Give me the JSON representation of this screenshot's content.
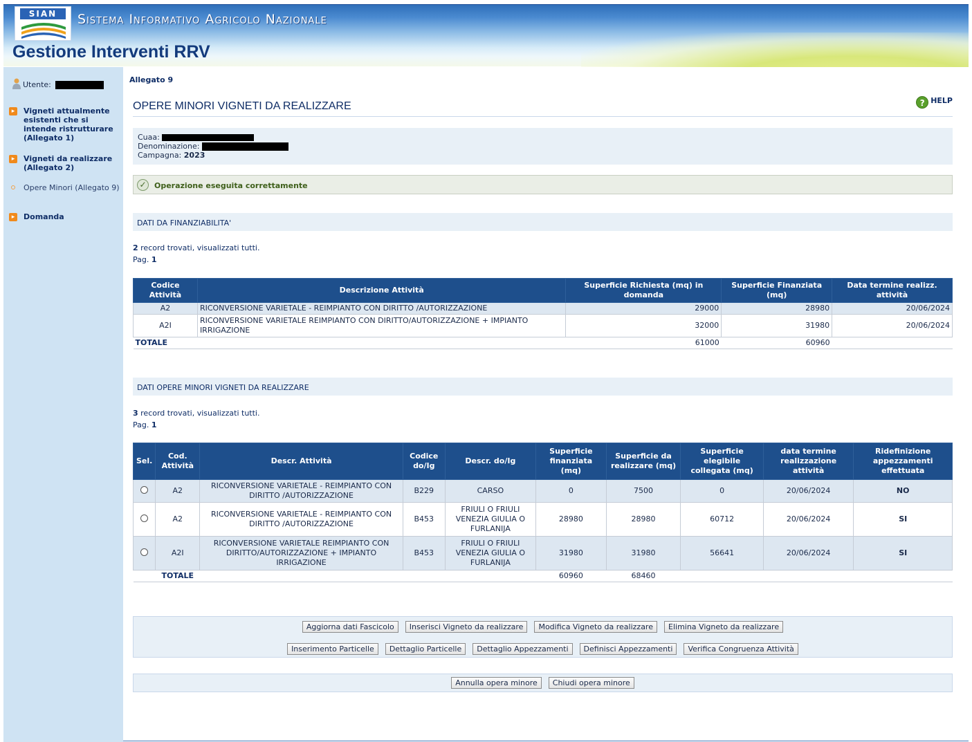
{
  "header": {
    "logo_text": "SIAN",
    "system_name": "Sistema Informativo Agricolo Nazionale",
    "app_title": "Gestione Interventi RRV"
  },
  "sidebar": {
    "user_label": "Utente:",
    "items": [
      {
        "label": "Vigneti attualmente esistenti che si intende ristrutturare (Allegato 1)",
        "active": false
      },
      {
        "label": "Vigneti da realizzare (Allegato 2)",
        "active": false
      },
      {
        "label": "Opere Minori (Allegato 9)",
        "active": true
      },
      {
        "label": "Domanda",
        "active": false
      }
    ]
  },
  "main": {
    "breadcrumb": "Allegato 9",
    "page_title": "OPERE MINORI VIGNETI DA REALIZZARE",
    "help_label": "HELP",
    "info": {
      "cuaa_label": "Cuaa:",
      "denominazione_label": "Denominazione:",
      "campagna_label": "Campagna:",
      "campagna_value": "2023"
    },
    "success_message": "Operazione eseguita correttamente",
    "section1": {
      "title": "DATI DA FINANZIABILITA'",
      "record_count": "2",
      "record_text": " record trovati, visualizzati tutti.",
      "page_label": "Pag. ",
      "page_value": "1",
      "columns": [
        "Codice Attività",
        "Descrizione Attività",
        "Superficie Richiesta (mq) in domanda",
        "Superficie Finanziata (mq)",
        "Data termine realizz. attività"
      ],
      "rows": [
        {
          "code": "A2",
          "desc": "RICONVERSIONE VARIETALE - REIMPIANTO CON DIRITTO /AUTORIZZAZIONE",
          "richiesta": "29000",
          "finanziata": "28980",
          "data": "20/06/2024"
        },
        {
          "code": "A2I",
          "desc": "RICONVERSIONE VARIETALE REIMPIANTO CON DIRITTO/AUTORIZZAZIONE + IMPIANTO IRRIGAZIONE",
          "richiesta": "32000",
          "finanziata": "31980",
          "data": "20/06/2024"
        }
      ],
      "total_label": "TOTALE",
      "total_richiesta": "61000",
      "total_finanziata": "60960"
    },
    "section2": {
      "title": "DATI OPERE MINORI VIGNETI DA REALIZZARE",
      "record_count": "3",
      "record_text": " record trovati, visualizzati tutti.",
      "page_label": "Pag. ",
      "page_value": "1",
      "columns": [
        "Sel.",
        "Cod. Attività",
        "Descr. Attività",
        "Codice do/Ig",
        "Descr. do/Ig",
        "Superficie finanziata (mq)",
        "Superficie da realizzare (mq)",
        "Superficie elegibile collegata (mq)",
        "data termine realizzazione attività",
        "Ridefinizione appezzamenti effettuata"
      ],
      "rows": [
        {
          "code": "A2",
          "desc": "RICONVERSIONE VARIETALE - REIMPIANTO CON DIRITTO /AUTORIZZAZIONE",
          "doig_code": "B229",
          "doig_desc": "CARSO",
          "finanziata": "0",
          "realizzare": "7500",
          "elegibile": "0",
          "data": "20/06/2024",
          "ridef": "NO"
        },
        {
          "code": "A2",
          "desc": "RICONVERSIONE VARIETALE - REIMPIANTO CON DIRITTO /AUTORIZZAZIONE",
          "doig_code": "B453",
          "doig_desc": "FRIULI O FRIULI VENEZIA GIULIA O FURLANIJA",
          "finanziata": "28980",
          "realizzare": "28980",
          "elegibile": "60712",
          "data": "20/06/2024",
          "ridef": "SI"
        },
        {
          "code": "A2I",
          "desc": "RICONVERSIONE VARIETALE REIMPIANTO CON DIRITTO/AUTORIZZAZIONE + IMPIANTO IRRIGAZIONE",
          "doig_code": "B453",
          "doig_desc": "FRIULI O FRIULI VENEZIA GIULIA O FURLANIJA",
          "finanziata": "31980",
          "realizzare": "31980",
          "elegibile": "56641",
          "data": "20/06/2024",
          "ridef": "SI"
        }
      ],
      "total_label": "TOTALE",
      "total_finanziata": "60960",
      "total_realizzare": "68460"
    },
    "buttons_row1": [
      "Aggiorna dati Fascicolo",
      "Inserisci Vigneto da realizzare",
      "Modifica Vigneto da realizzare",
      "Elimina Vigneto da realizzare"
    ],
    "buttons_row2": [
      "Inserimento Particelle",
      "Dettaglio Particelle",
      "Dettaglio Appezzamenti",
      "Definisci Appezzamenti",
      "Verifica Congruenza Attività"
    ],
    "buttons_row3": [
      "Annulla opera minore",
      "Chiudi opera minore"
    ]
  },
  "colors": {
    "table_header": "#1e4f8c",
    "sidebar_bg": "#cfe3f3",
    "accent_orange": "#f08a1c",
    "status_no": "#e89a12",
    "status_si": "#2f8a22"
  }
}
